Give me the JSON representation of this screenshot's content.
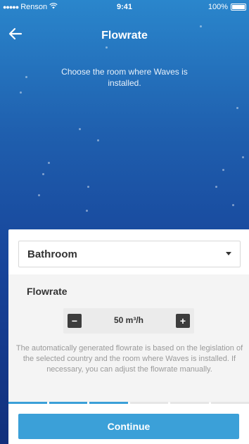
{
  "status_bar": {
    "carrier": "Renson",
    "signal_dots": "●●●●●",
    "wifi_icon": "wifi-icon",
    "time": "9:41",
    "battery": "100%"
  },
  "nav": {
    "back_icon": "arrow-left-icon",
    "title": "Flowrate"
  },
  "instruction": "Choose the room where Waves is installed.",
  "room_select": {
    "selected": "Bathroom",
    "caret_icon": "caret-down-icon"
  },
  "flowrate": {
    "heading": "Flowrate",
    "minus_label": "−",
    "plus_label": "+",
    "value": "50 m³/h",
    "description": "The automatically generated flowrate is based on the legislation of the selected country and the room where Waves is installed. If necessary, you can adjust the flowrate manually."
  },
  "progress": {
    "steps": 6,
    "completed": 3
  },
  "continue_label": "Continue",
  "colors": {
    "accent": "#3ba0d8",
    "background_top": "#2a86cc",
    "background_bottom": "#122f7c"
  }
}
